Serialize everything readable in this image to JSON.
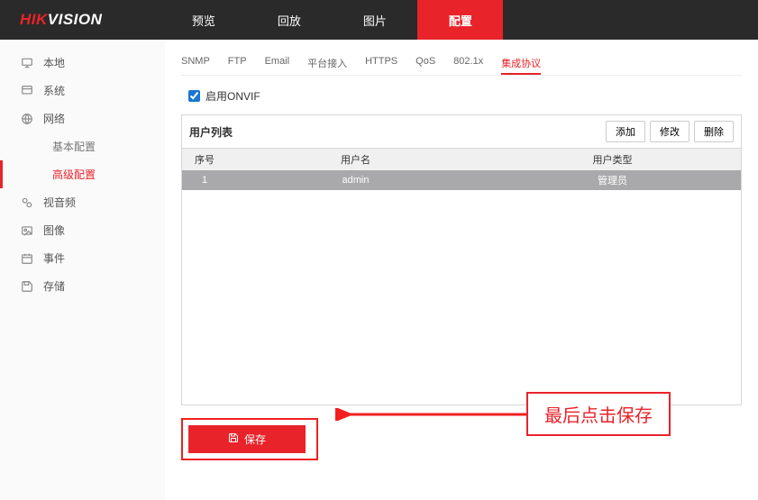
{
  "logo": {
    "prefix": "HIK",
    "suffix": "VISION"
  },
  "topNav": {
    "items": [
      {
        "label": "预览"
      },
      {
        "label": "回放"
      },
      {
        "label": "图片"
      },
      {
        "label": "配置"
      }
    ],
    "activeIndex": 3
  },
  "sidebar": {
    "local": {
      "label": "本地"
    },
    "system": {
      "label": "系统"
    },
    "network": {
      "label": "网络"
    },
    "network_sub": {
      "basic": {
        "label": "基本配置"
      },
      "advanced": {
        "label": "高级配置"
      }
    },
    "av": {
      "label": "视音频"
    },
    "image": {
      "label": "图像"
    },
    "event": {
      "label": "事件"
    },
    "storage": {
      "label": "存储"
    }
  },
  "subTabs": {
    "items": [
      {
        "label": "SNMP"
      },
      {
        "label": "FTP"
      },
      {
        "label": "Email"
      },
      {
        "label": "平台接入"
      },
      {
        "label": "HTTPS"
      },
      {
        "label": "QoS"
      },
      {
        "label": "802.1x"
      },
      {
        "label": "集成协议"
      }
    ],
    "activeIndex": 7
  },
  "enableOnvif": {
    "label": "启用ONVIF",
    "checked": true
  },
  "userPanel": {
    "title": "用户列表",
    "buttons": {
      "add": "添加",
      "edit": "修改",
      "delete": "删除"
    },
    "columns": {
      "no": "序号",
      "username": "用户名",
      "userType": "用户类型"
    },
    "rows": [
      {
        "no": "1",
        "username": "admin",
        "userType": "管理员"
      }
    ]
  },
  "save": {
    "label": "保存"
  },
  "annotation": {
    "text": "最后点击保存"
  }
}
